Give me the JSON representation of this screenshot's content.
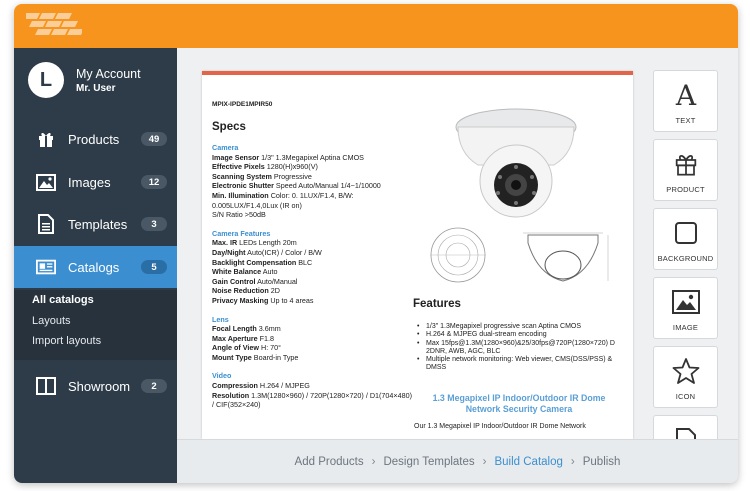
{
  "account": {
    "title": "My Account",
    "user": "Mr. User",
    "avatar_letter": "L"
  },
  "nav": [
    {
      "label": "Products",
      "badge": "49",
      "icon": "gift-icon"
    },
    {
      "label": "Images",
      "badge": "12",
      "icon": "image-icon"
    },
    {
      "label": "Templates",
      "badge": "3",
      "icon": "document-icon"
    },
    {
      "label": "Catalogs",
      "badge": "5",
      "icon": "catalog-icon",
      "active": true
    },
    {
      "label": "Showroom",
      "badge": "2",
      "icon": "book-icon"
    }
  ],
  "subnav": [
    "All catalogs",
    "Layouts",
    "Import layouts"
  ],
  "document": {
    "model": "MPIX-IPDE1MPIR50",
    "specs_title": "Specs",
    "sections": [
      {
        "title": "Camera",
        "lines": [
          [
            "Image Sensor",
            " 1/3\" 1.3Megapixel Aptina CMOS"
          ],
          [
            "Effective Pixels",
            " 1280(H)x960(V)"
          ],
          [
            "Scanning System",
            " Progressive"
          ],
          [
            "Electronic Shutter",
            " Speed Auto/Manual 1/4~1/10000"
          ],
          [
            "Min. Illumination",
            " Color: 0. 1LUX/F1.4, B/W: 0.005LUX/F1.4,0Lux (IR on)"
          ],
          [
            "",
            "S/N Ratio >50dB"
          ]
        ]
      },
      {
        "title": "Camera Features",
        "lines": [
          [
            "Max. IR",
            " LEDs Length 20m"
          ],
          [
            "Day/Night",
            " Auto(ICR) / Color / B/W"
          ],
          [
            "Backlight Compensation",
            " BLC"
          ],
          [
            "White Balance",
            " Auto"
          ],
          [
            "Gain Control",
            " Auto/Manual"
          ],
          [
            "Noise Reduction",
            " 2D"
          ],
          [
            "Privacy Masking",
            " Up to 4 areas"
          ]
        ]
      },
      {
        "title": "Lens",
        "lines": [
          [
            "Focal Length",
            " 3.6mm"
          ],
          [
            "Max Aperture",
            " F1.8"
          ],
          [
            "Angle of View",
            " H: 70°"
          ],
          [
            "Mount Type",
            " Board-in Type"
          ]
        ]
      },
      {
        "title": "Video",
        "lines": [
          [
            "Compression",
            " H.264 / MJPEG"
          ],
          [
            "Resolution",
            " 1.3M(1280×960) / 720P(1280×720) / D1(704×480) / CIF(352×240)"
          ]
        ]
      }
    ],
    "features_title": "Features",
    "features": [
      "1/3\" 1.3Megapixel progressive scan Aptina CMOS",
      "H.264 & MJPEG dual-stream encoding",
      "Max 15fps@1.3M(1280×960)&25/30fps@720P(1280×720) D 2DNR, AWB, AGC, BLC",
      "Multiple network monitoring: Web viewer, CMS(DSS/PSS) & DMSS"
    ],
    "subtitle": "1.3 Megapixel IP Indoor/Outdoor IR Dome Network Security Camera",
    "paragraph": "Our 1.3 Megapixel IP Indoor/Outdoor IR Dome Network"
  },
  "tools": [
    {
      "label": "TEXT",
      "icon": "text-icon"
    },
    {
      "label": "PRODUCT",
      "icon": "gift-icon"
    },
    {
      "label": "BACKGROUND",
      "icon": "square-icon"
    },
    {
      "label": "IMAGE",
      "icon": "image-icon"
    },
    {
      "label": "ICON",
      "icon": "star-icon"
    }
  ],
  "breadcrumb": [
    "Add Products",
    "Design Templates",
    "Build Catalog",
    "Publish"
  ],
  "breadcrumb_current": "Build Catalog",
  "colors": {
    "topbar": "#f7941d",
    "sidebar": "#2e3b48",
    "active": "#3b8fd1",
    "doc_accent": "#e2654a"
  }
}
